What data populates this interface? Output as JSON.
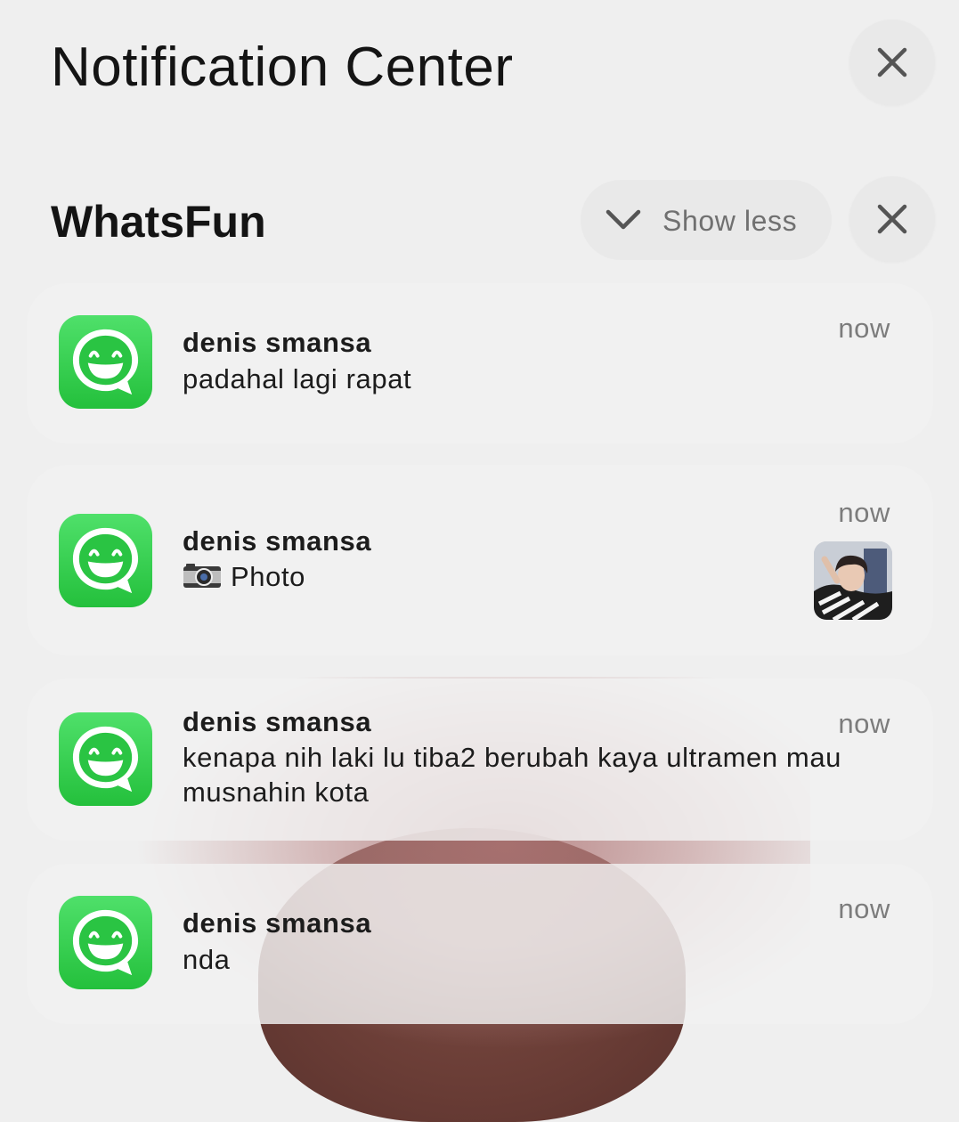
{
  "header": {
    "title": "Notification Center",
    "close_icon": "close-icon"
  },
  "group": {
    "app_name": "WhatsFun",
    "toggle_label": "Show less",
    "toggle_icon": "chevron-down-icon",
    "clear_icon": "close-icon"
  },
  "notifications": [
    {
      "sender": "denis smansa",
      "message": "padahal lagi rapat",
      "time": "now"
    },
    {
      "sender": "denis smansa",
      "message": "Photo",
      "message_icon": "camera-icon",
      "time": "now",
      "has_thumbnail": true
    },
    {
      "sender": "denis smansa",
      "message": "kenapa nih laki lu tiba2 berubah kaya ultramen mau musnahin kota",
      "time": "now"
    },
    {
      "sender": "denis smansa",
      "message": "nda",
      "time": "now"
    }
  ],
  "colors": {
    "app_icon_green": "#2ac443",
    "background": "#efefef"
  }
}
